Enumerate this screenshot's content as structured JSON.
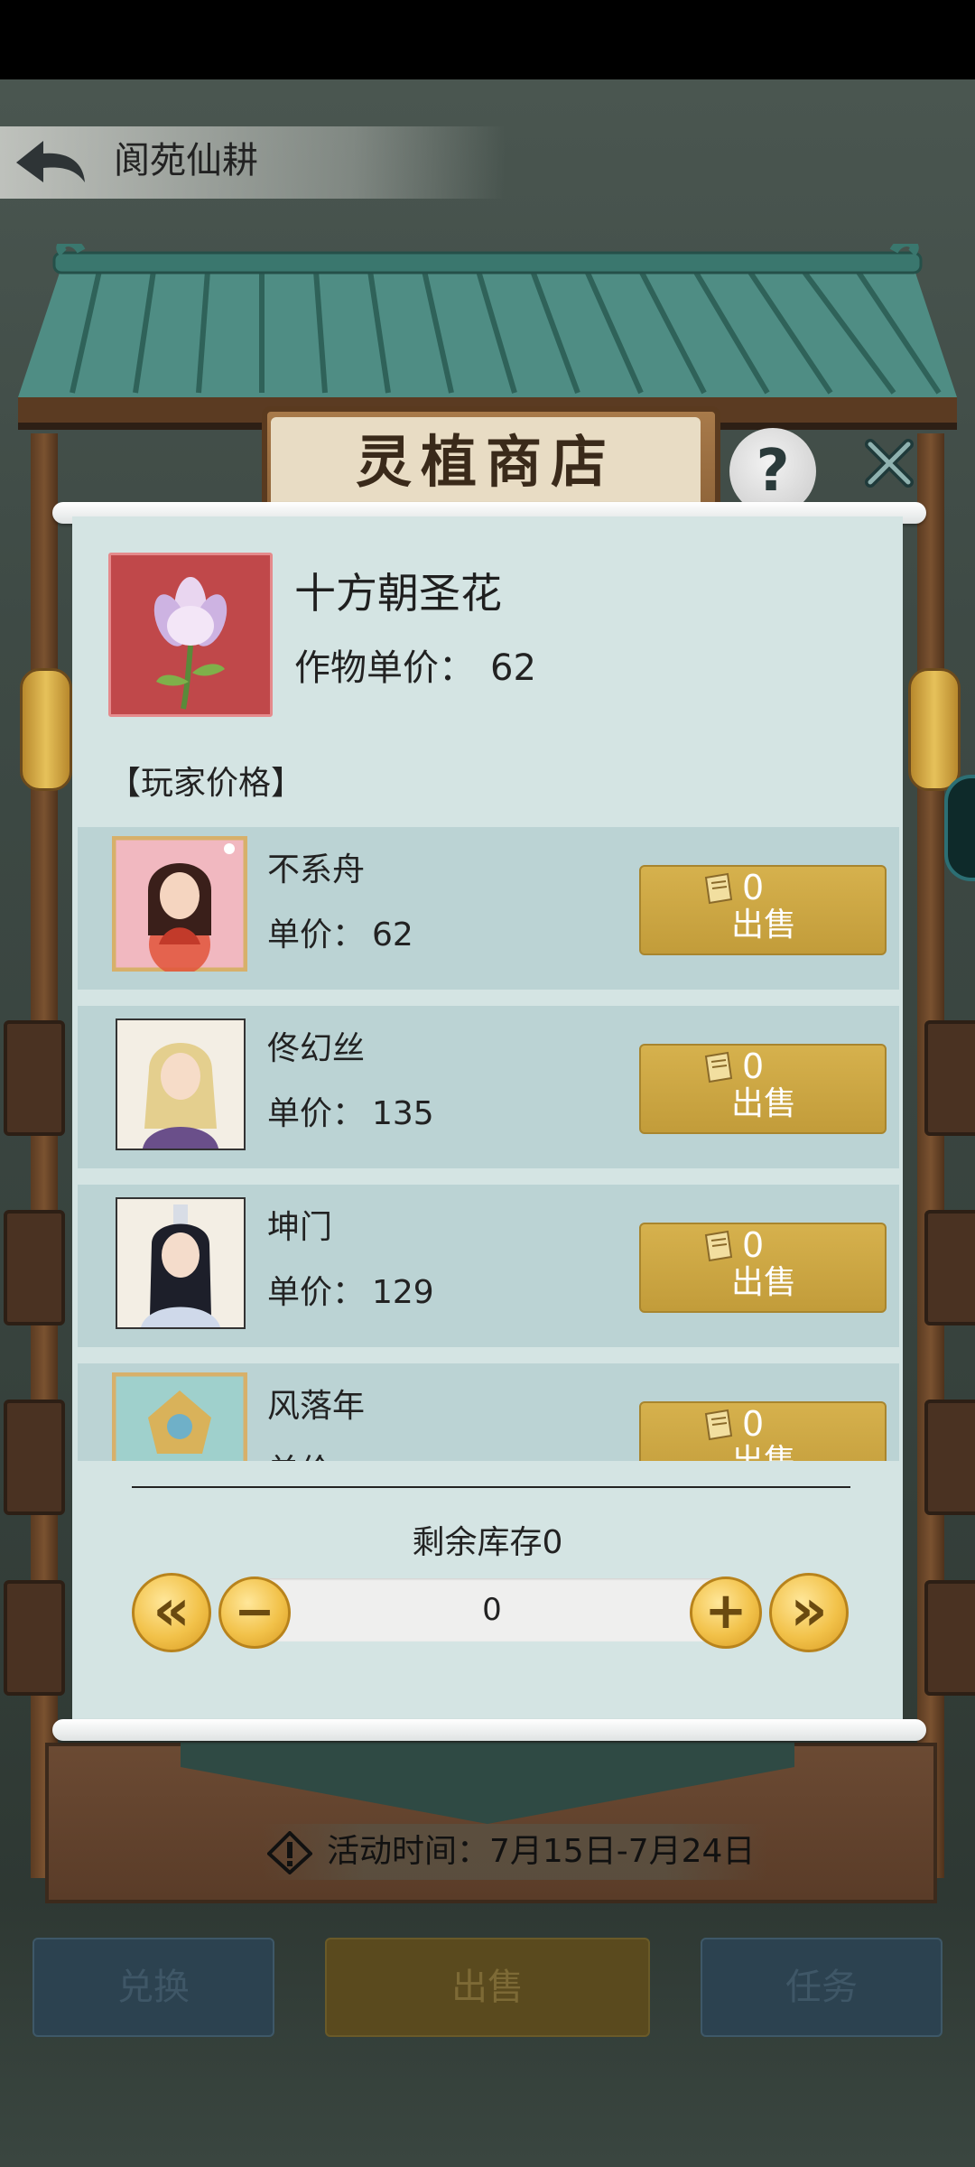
{
  "header": {
    "title": "阆苑仙耕",
    "back_icon": "back-arrow-icon"
  },
  "shop": {
    "title": "灵植商店",
    "help_label": "?"
  },
  "item": {
    "name": "十方朝圣花",
    "price_label": "作物单价：",
    "price_value": "62",
    "icon": "lotus-flower-icon"
  },
  "players_section_label": "【玩家价格】",
  "players": [
    {
      "name": "不系舟",
      "price_label": "单价：",
      "price": "62",
      "sell_count": "0",
      "sell_label": "出售"
    },
    {
      "name": "佟幻丝",
      "price_label": "单价：",
      "price": "135",
      "sell_count": "0",
      "sell_label": "出售"
    },
    {
      "name": "坤门",
      "price_label": "单价：",
      "price": "129",
      "sell_count": "0",
      "sell_label": "出售"
    },
    {
      "name": "风落年",
      "price_label": "单价：",
      "price": "",
      "sell_count": "0",
      "sell_label": "出售"
    }
  ],
  "stock_label": "剩余库存0",
  "quantity": {
    "value": "0",
    "decrease_max_label": "«",
    "decrease_label": "−",
    "increase_label": "+",
    "increase_max_label": "»"
  },
  "activity_text": "活动时间：7月15日-7月24日",
  "tabs": [
    {
      "label": "兑换"
    },
    {
      "label": "出售"
    },
    {
      "label": "任务"
    }
  ],
  "colors": {
    "panel": "#d4e4e3",
    "row": "#bbd3d4",
    "sell_button": "#c9a443",
    "item_icon_bg": "#c0484a"
  }
}
